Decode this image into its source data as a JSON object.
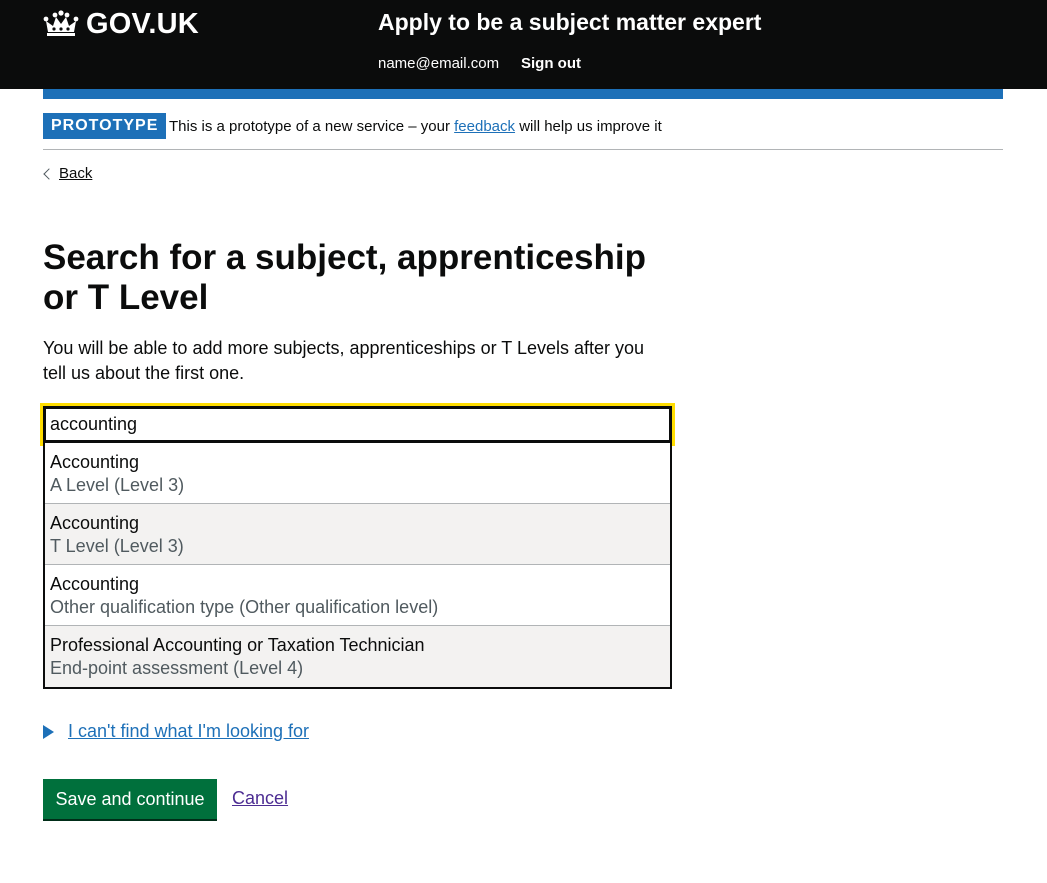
{
  "header": {
    "logo_text": "GOV.UK",
    "logo_icon": "crown-icon",
    "service_name": "Apply to be a subject matter expert",
    "account_email": "name@email.com",
    "sign_out_label": "Sign out"
  },
  "phase_banner": {
    "tag": "PROTOTYPE",
    "text_before": "This is a prototype of a new service – your ",
    "link_text": "feedback",
    "text_after": " will help us improve it"
  },
  "back_link": {
    "label": "Back",
    "icon": "chevron-left-icon"
  },
  "main": {
    "title": "Search for a subject, apprenticeship or T Level",
    "hint": "You will be able to add more subjects, apprenticeships or T Levels after you tell us about the first one."
  },
  "search": {
    "value": "accounting",
    "options": [
      {
        "title": "Accounting",
        "subtitle": "A Level (Level 3)"
      },
      {
        "title": "Accounting",
        "subtitle": "T Level (Level 3)"
      },
      {
        "title": "Accounting",
        "subtitle": "Other qualification type (Other qualification level)"
      },
      {
        "title": "Professional Accounting or Taxation Technician",
        "subtitle": "End-point assessment (Level 4)"
      }
    ]
  },
  "details": {
    "summary": "I can't find what I'm looking for",
    "icon": "triangle-right-icon"
  },
  "actions": {
    "save_label": "Save and continue",
    "cancel_label": "Cancel"
  },
  "colors": {
    "header_bg": "#0b0c0c",
    "brand_blue": "#1d70b8",
    "focus_yellow": "#ffdd00",
    "button_green": "#00703c",
    "visited_link": "#4c2c92",
    "secondary_text": "#505a5f"
  }
}
